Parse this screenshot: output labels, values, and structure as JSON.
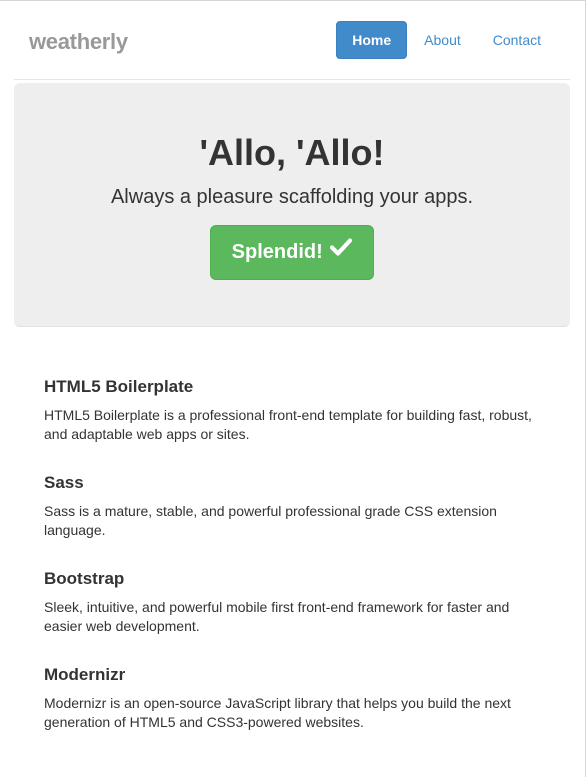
{
  "header": {
    "brand": "weatherly",
    "nav": [
      {
        "label": "Home",
        "active": true
      },
      {
        "label": "About",
        "active": false
      },
      {
        "label": "Contact",
        "active": false
      }
    ]
  },
  "jumbotron": {
    "title": "'Allo, 'Allo!",
    "lead": "Always a pleasure scaffolding your apps.",
    "button_label": "Splendid!",
    "button_icon": "check-icon"
  },
  "features": [
    {
      "title": "HTML5 Boilerplate",
      "description": "HTML5 Boilerplate is a professional front-end template for building fast, robust, and adaptable web apps or sites."
    },
    {
      "title": "Sass",
      "description": "Sass is a mature, stable, and powerful professional grade CSS extension language."
    },
    {
      "title": "Bootstrap",
      "description": "Sleek, intuitive, and powerful mobile first front-end framework for faster and easier web development."
    },
    {
      "title": "Modernizr",
      "description": "Modernizr is an open-source JavaScript library that helps you build the next generation of HTML5 and CSS3-powered websites."
    }
  ],
  "colors": {
    "brand_text": "#999999",
    "nav_active_bg": "#428bca",
    "link": "#428bca",
    "jumbotron_bg": "#eeeeee",
    "success_button": "#5cb85c"
  }
}
